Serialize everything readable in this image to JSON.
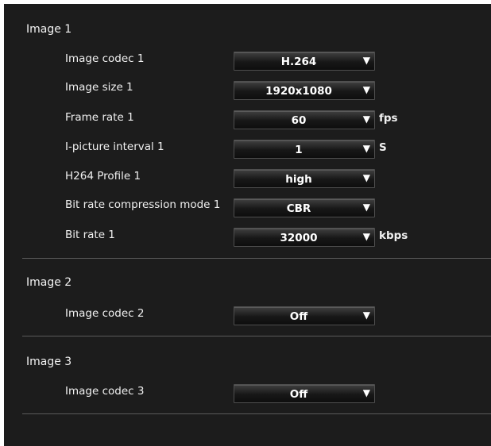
{
  "sections": [
    {
      "title": "Image 1",
      "rows": [
        {
          "label": "Image codec 1",
          "value": "H.264",
          "unit": ""
        },
        {
          "label": "Image size 1",
          "value": "1920x1080",
          "unit": ""
        },
        {
          "label": "Frame rate 1",
          "value": "60",
          "unit": "fps"
        },
        {
          "label": "I-picture interval 1",
          "value": "1",
          "unit": "S"
        },
        {
          "label": "H264 Profile 1",
          "value": "high",
          "unit": ""
        },
        {
          "label": "Bit rate compression mode 1",
          "value": "CBR",
          "unit": ""
        },
        {
          "label": "Bit rate 1",
          "value": "32000",
          "unit": "kbps"
        }
      ]
    },
    {
      "title": "Image 2",
      "rows": [
        {
          "label": "Image codec 2",
          "value": "Off",
          "unit": ""
        }
      ]
    },
    {
      "title": "Image 3",
      "rows": [
        {
          "label": "Image codec 3",
          "value": "Off",
          "unit": ""
        }
      ]
    }
  ],
  "icons": {
    "dropdown": "triangle-down-icon"
  },
  "colors": {
    "panel_bg": "#1c1c1c",
    "divider": "#5a5a5a",
    "text": "#f0f0f0"
  }
}
